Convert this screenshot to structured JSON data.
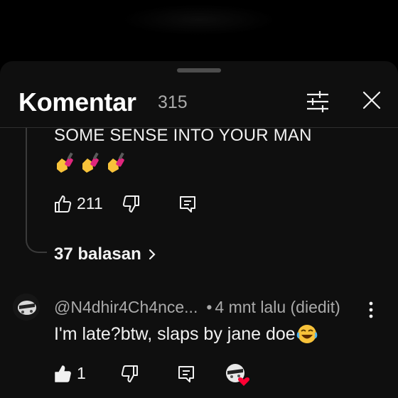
{
  "header": {
    "title": "Komentar",
    "count": "315"
  },
  "reply": {
    "text": "SOME SENSE INTO YOUR MAN",
    "emoji": [
      "nail-polish",
      "nail-polish",
      "nail-polish"
    ],
    "likes": "211"
  },
  "replies_link": "37 balasan",
  "comment": {
    "author": "@N4dhir4Ch4nce...",
    "time": "4 mnt lalu (diedit)",
    "text": "I'm late?btw, slaps by jane doe",
    "likes": "1"
  },
  "colors": {
    "sheet_bg": "#0f0f0f",
    "text": "#f1f1f1",
    "muted": "#aaaaaa",
    "heart": "#ff0033"
  }
}
